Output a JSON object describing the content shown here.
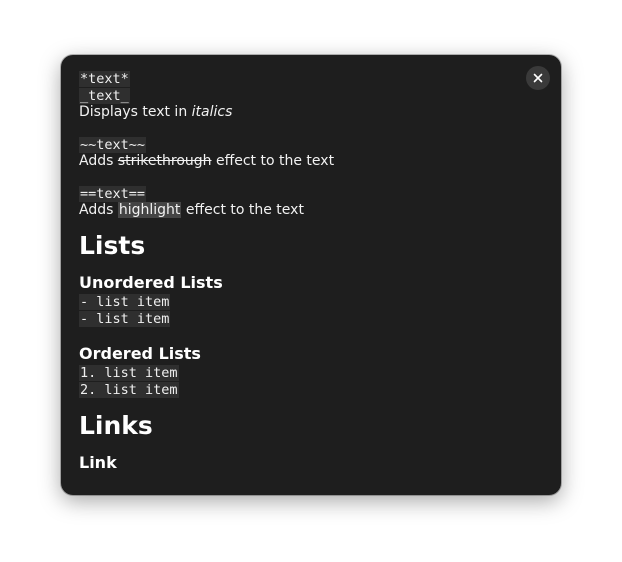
{
  "dialog": {
    "close_icon": "close-icon",
    "italics": {
      "syntax_1": "*text*",
      "syntax_2": "_text_",
      "desc_prefix": "Displays text in ",
      "desc_em": "italics"
    },
    "strikethrough": {
      "syntax": "~~text~~",
      "desc_prefix": "Adds ",
      "desc_styled": "strikethrough",
      "desc_suffix": " effect to the text"
    },
    "highlight": {
      "syntax": "==text==",
      "desc_prefix": "Adds ",
      "desc_styled": "highlight",
      "desc_suffix": " effect to the text"
    },
    "lists": {
      "heading": "Lists",
      "unordered": {
        "heading": "Unordered Lists",
        "items": [
          "- list item",
          "- list item"
        ]
      },
      "ordered": {
        "heading": "Ordered Lists",
        "items": [
          "1. list item",
          "2. list item"
        ]
      }
    },
    "links": {
      "heading": "Links",
      "link_heading": "Link"
    }
  }
}
